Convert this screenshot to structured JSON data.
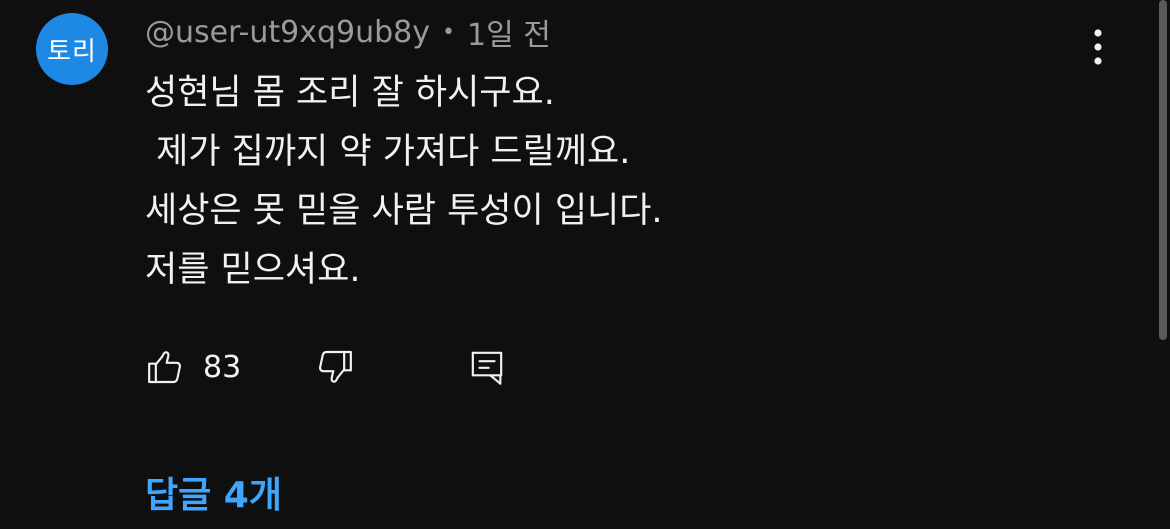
{
  "comment": {
    "avatar_text": "토리",
    "avatar_color": "#1e88e5",
    "username": "@user-ut9xq9ub8y",
    "separator": "•",
    "timestamp": "1일 전",
    "lines": [
      "성현님 몸 조리 잘 하시구요.",
      " 제가 집까지 약 가져다 드릴께요.",
      "세상은 못 믿을 사람 투성이 입니다.",
      "저를 믿으셔요."
    ],
    "like_count": "83",
    "replies_label": "답글 4개"
  },
  "icons": {
    "more": "more-vert-icon",
    "like": "thumbs-up-icon",
    "dislike": "thumbs-down-icon",
    "reply": "comment-reply-icon"
  },
  "colors": {
    "background": "#0f0f0f",
    "text": "#f1f1f1",
    "secondary_text": "#9a9a9a",
    "link": "#3ea6ff"
  }
}
